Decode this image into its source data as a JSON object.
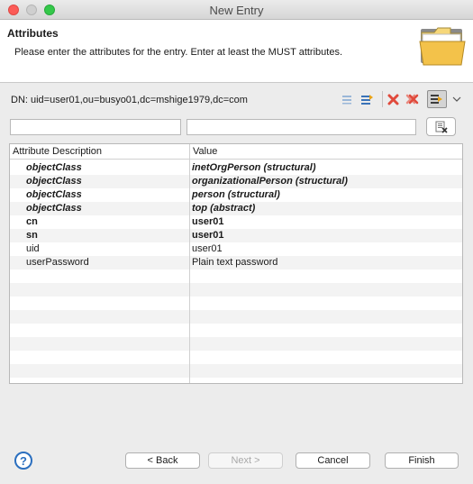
{
  "window": {
    "title": "New Entry"
  },
  "header": {
    "title": "Attributes",
    "description": "Please enter the attributes for the entry. Enter at least the MUST attributes."
  },
  "dn_label": "DN: uid=user01,ou=busyo01,dc=mshige1979,dc=com",
  "filters": {
    "attribute_value": "",
    "value_value": ""
  },
  "table": {
    "columns": [
      "Attribute Description",
      "Value"
    ],
    "rows": [
      {
        "attribute": "objectClass",
        "value": "inetOrgPerson (structural)",
        "style": "objectclass"
      },
      {
        "attribute": "objectClass",
        "value": "organizationalPerson (structural)",
        "style": "objectclass"
      },
      {
        "attribute": "objectClass",
        "value": "person (structural)",
        "style": "objectclass"
      },
      {
        "attribute": "objectClass",
        "value": "top (abstract)",
        "style": "objectclass"
      },
      {
        "attribute": "cn",
        "value": "user01",
        "style": "must"
      },
      {
        "attribute": "sn",
        "value": "user01",
        "style": "must"
      },
      {
        "attribute": "uid",
        "value": "user01",
        "style": "normal"
      },
      {
        "attribute": "userPassword",
        "value": "Plain text password",
        "style": "normal"
      }
    ]
  },
  "buttons": {
    "back": "< Back",
    "next": "Next >",
    "cancel": "Cancel",
    "finish": "Finish"
  },
  "help_symbol": "?",
  "colors": {
    "accent_blue": "#2b6fbf",
    "delete_red": "#e04a3c",
    "folder_yellow": "#f3c24a"
  }
}
